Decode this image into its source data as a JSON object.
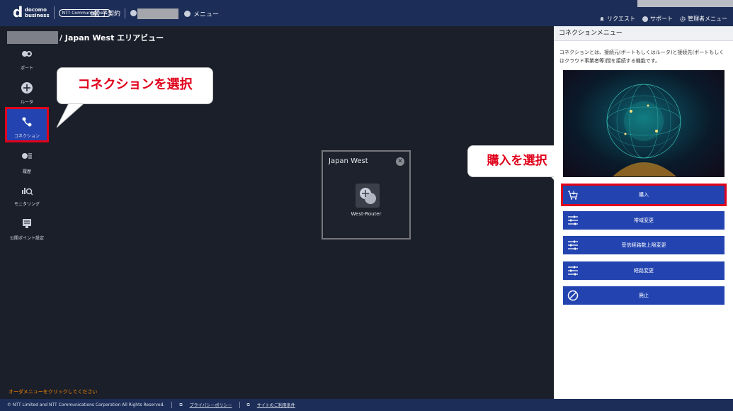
{
  "header": {
    "logo_main": "docomo\nbusiness",
    "logo_partner": "NTT Communications",
    "contract_label": "子契約",
    "menu_label": "メニュー",
    "right_nav": [
      {
        "label": "リクエスト",
        "icon": "bell-icon"
      },
      {
        "label": "サポート",
        "icon": "help-icon"
      },
      {
        "label": "管理者メニュー",
        "icon": "gear-icon"
      }
    ]
  },
  "breadcrumb": {
    "text": "/ Japan West エリアビュー"
  },
  "sidebar": {
    "items": [
      {
        "label": "ポート",
        "icon": "port-icon"
      },
      {
        "label": "ルータ",
        "icon": "router-icon"
      },
      {
        "label": "コネクション",
        "icon": "connection-icon"
      },
      {
        "label": "履歴",
        "icon": "history-icon"
      },
      {
        "label": "モニタリング",
        "icon": "monitoring-icon"
      },
      {
        "label": "公開ポイント設定",
        "icon": "public-point-icon"
      }
    ]
  },
  "callouts": {
    "select_connection": "コネクションを選択",
    "select_purchase": "購入を選択"
  },
  "region": {
    "title": "Japan West",
    "router_label": "West-Router"
  },
  "order_hint": "オーダメニューをクリックしてください",
  "panel": {
    "title": "コネクションメニュー",
    "description": "コネクションとは、接続元(ポートもしくはルータ)と接続先(ポートもしくはクラウド事業者等)間を接続する機能です。",
    "buttons": [
      {
        "label": "購入",
        "icon": "cart-icon"
      },
      {
        "label": "帯域変更",
        "icon": "sliders-icon"
      },
      {
        "label": "受信経路数上限変更",
        "icon": "sliders-icon"
      },
      {
        "label": "経路変更",
        "icon": "sliders-icon"
      },
      {
        "label": "廃止",
        "icon": "prohibit-icon"
      }
    ]
  },
  "footer": {
    "copyright": "© NTT Limited and NTT Communications Corporation All Rights Reserved.",
    "privacy": "プライバシーポリシー",
    "terms": "サイトのご利用条件"
  },
  "colors": {
    "header_bg": "#1c2d57",
    "accent_blue": "#2344b0",
    "highlight_red": "#e0001b",
    "hint_orange": "#ff8a00"
  }
}
